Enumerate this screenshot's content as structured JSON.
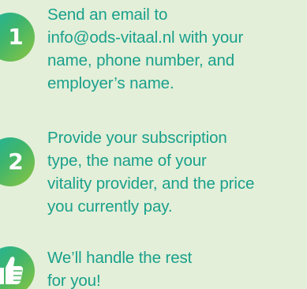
{
  "steps": [
    {
      "number": "1",
      "lines": [
        "Send an email to",
        "info@ods-vitaal.nl with your",
        "name, phone number, and",
        "employer’s name."
      ]
    },
    {
      "number": "2",
      "lines": [
        "Provide your subscription",
        "type, the name of your",
        "vitality provider, and the price",
        "you currently pay."
      ]
    },
    {
      "icon": "thumbs-up-icon",
      "lines": [
        "We’ll handle the rest",
        "for you!"
      ]
    }
  ],
  "colors": {
    "background": "#e3efd8",
    "text": "#1aa08c",
    "badge_gradient_start": "#1db3a2",
    "badge_gradient_end": "#8cc63f"
  }
}
